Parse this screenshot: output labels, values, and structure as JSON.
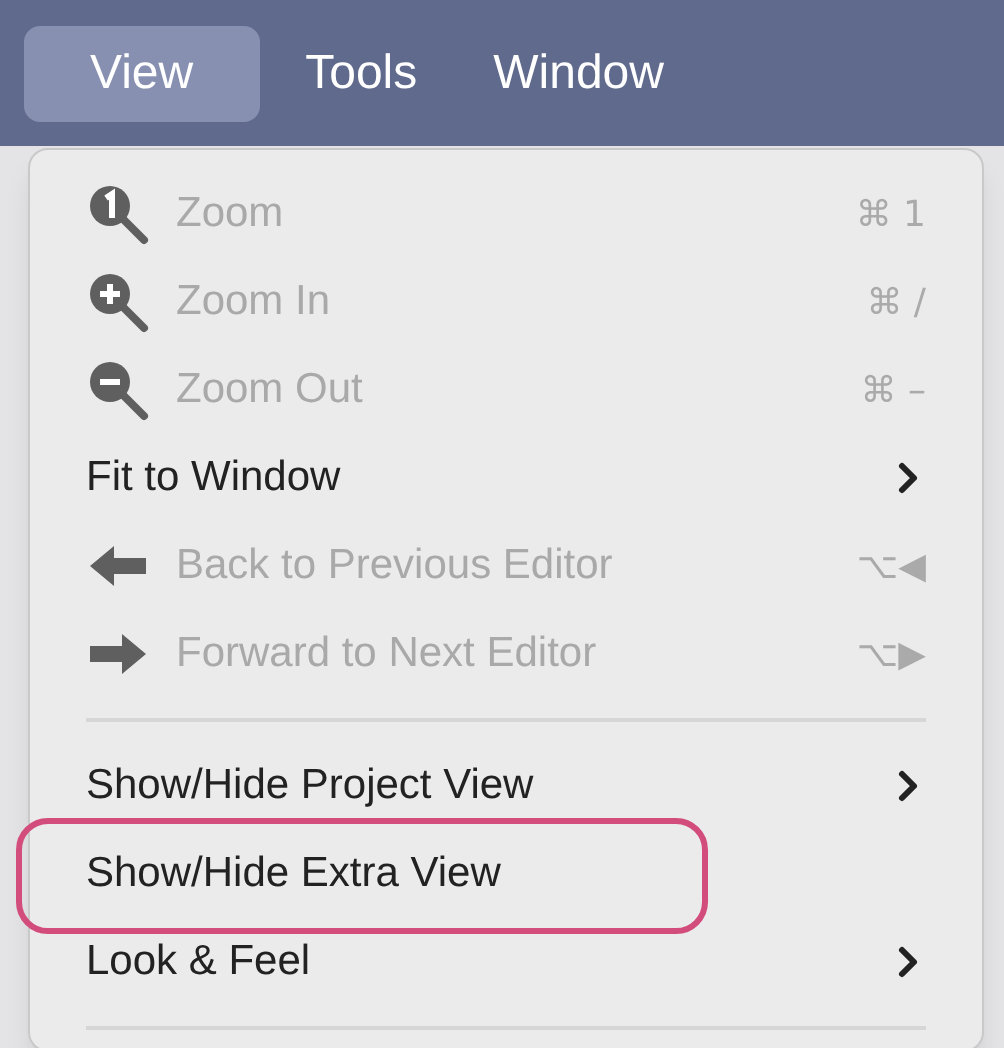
{
  "menu_bar": [
    {
      "label": "View",
      "selected": true
    },
    {
      "label": "Tools",
      "selected": false
    },
    {
      "label": "Window",
      "selected": false
    }
  ],
  "menu": {
    "items": [
      {
        "kind": "item",
        "label": "Zoom",
        "disabled": true,
        "shortcut": "⌘ 1",
        "submenu": false,
        "highlighted": false
      },
      {
        "kind": "item",
        "label": "Zoom In",
        "disabled": true,
        "shortcut": "⌘ /",
        "submenu": false,
        "highlighted": false
      },
      {
        "kind": "item",
        "label": "Zoom Out",
        "disabled": true,
        "shortcut": "⌘ –",
        "submenu": false,
        "highlighted": false
      },
      {
        "kind": "item",
        "label": "Fit to Window",
        "disabled": false,
        "submenu": true,
        "highlighted": false
      },
      {
        "kind": "item",
        "label": "Back to Previous Editor",
        "disabled": true,
        "shortcut": "⌥◀",
        "submenu": false,
        "highlighted": false
      },
      {
        "kind": "item",
        "label": "Forward to Next Editor",
        "disabled": true,
        "shortcut": "⌥▶",
        "submenu": false,
        "highlighted": false
      },
      {
        "kind": "separator"
      },
      {
        "kind": "item",
        "label": "Show/Hide Project View",
        "disabled": false,
        "submenu": true,
        "highlighted": false
      },
      {
        "kind": "item",
        "label": "Show/Hide Extra View",
        "disabled": false,
        "submenu": false,
        "highlighted": true
      },
      {
        "kind": "item",
        "label": "Look & Feel",
        "disabled": false,
        "submenu": true,
        "highlighted": false
      },
      {
        "kind": "separator"
      }
    ]
  }
}
